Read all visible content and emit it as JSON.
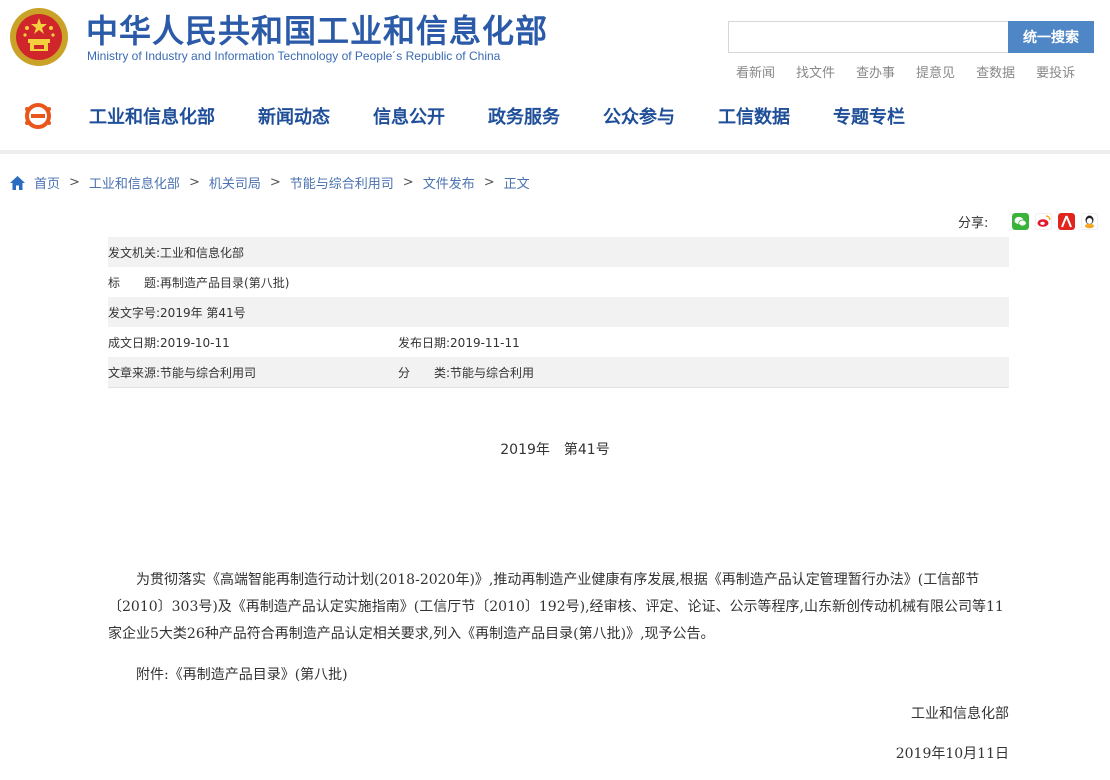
{
  "header": {
    "title_cn": "中华人民共和国工业和信息化部",
    "title_en": "Ministry of Industry and Information Technology of People´s Republic of China",
    "search": {
      "placeholder": "",
      "button_label": "统一搜索"
    },
    "quick_links": [
      "看新闻",
      "找文件",
      "查办事",
      "提意见",
      "查数据",
      "要投诉"
    ]
  },
  "nav": {
    "items": [
      "工业和信息化部",
      "新闻动态",
      "信息公开",
      "政务服务",
      "公众参与",
      "工信数据",
      "专题专栏"
    ]
  },
  "breadcrumb": {
    "items": [
      "首页",
      "工业和信息化部",
      "机关司局",
      "节能与综合利用司",
      "文件发布",
      "正文"
    ],
    "separator": ">"
  },
  "share": {
    "label": "分享:",
    "icons": [
      "wechat-icon",
      "weibo-icon",
      "renren-icon",
      "qzone-icon"
    ]
  },
  "meta": {
    "issuer_label": "发文机关:",
    "issuer": "工业和信息化部",
    "title_label": "标　　题:",
    "title": "再制造产品目录(第八批)",
    "doc_no_label": "发文字号:",
    "doc_no": "2019年 第41号",
    "created_label": "成文日期:",
    "created": "2019-10-11",
    "published_label": "发布日期:",
    "published": "2019-11-11",
    "source_label": "文章来源:",
    "source": "节能与综合利用司",
    "category_label": "分　　类:",
    "category": "节能与综合利用"
  },
  "body": {
    "doc_number": "2019年　第41号",
    "paragraph_1": "为贯彻落实《高端智能再制造行动计划(2018-2020年)》,推动再制造产业健康有序发展,根据《再制造产品认定管理暂行办法》(工信部节〔2010〕303号)及《再制造产品认定实施指南》(工信厅节〔2010〕192号),经审核、评定、论证、公示等程序,山东新创传动机械有限公司等11家企业5大类26种产品符合再制造产品认定相关要求,列入《再制造产品目录(第八批)》,现予公告。",
    "paragraph_2": "附件:《再制造产品目录》(第八批)",
    "signature_org": "工业和信息化部",
    "signature_date": "2019年10月11日"
  },
  "colors": {
    "title_blue": "#2b5aa8",
    "nav_blue": "#1f4f99",
    "search_button": "#4f86c6",
    "meta_shade": "#f2f2f2"
  }
}
